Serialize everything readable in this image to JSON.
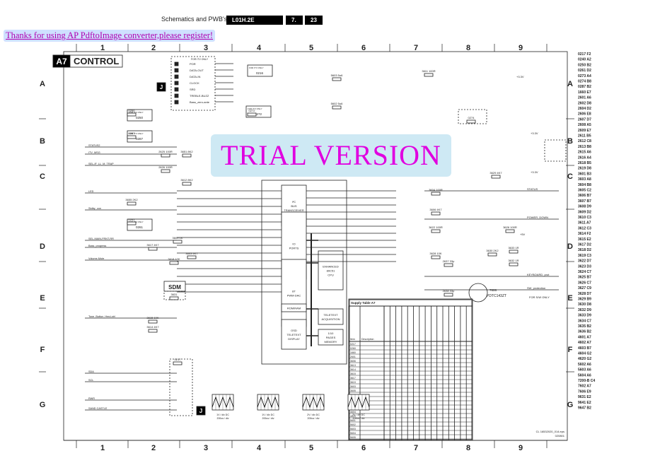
{
  "header": {
    "section": "Schematics and PWB's",
    "model": "L01H.2E",
    "chapter": "7.",
    "page": "23"
  },
  "register_notice": "Thanks for using AP PdftoImage converter,please register!",
  "watermark": "TRIAL VERSION",
  "title": {
    "badge": "A7",
    "name": "CONTROL"
  },
  "grid": {
    "columns": [
      "1",
      "2",
      "3",
      "4",
      "5",
      "6",
      "7",
      "8",
      "9"
    ],
    "rows": [
      "A",
      "B",
      "C",
      "D",
      "E",
      "F",
      "G"
    ]
  },
  "blocks": {
    "transceiver": "I²C BUS TRANSCEIVER",
    "io_ports": "IO PORTS",
    "pwm_dac": "8T PWM-DAC",
    "rom_ram": "ROM/RAM",
    "osd": "OSD TELETEXT DISPLAY",
    "cpu": "ENHANCED 80C51 CPU",
    "acquisition": "TELETEXT ACQUISITION",
    "memory": "1/10 PAGES MEMORY",
    "sdm": "SDM",
    "transistor": "7606 PDTC143ZT",
    "itv1": "FOR ITV ONLY",
    "itv_note": "FOR S/W ONLY"
  },
  "signals": [
    "POR",
    "DATA-OUT",
    "DATA-IN",
    "CLOCK",
    "SRD",
    "TREBLE-BUZZ",
    "Bass_zero-ante",
    "STATUS2",
    "ITV_MSG",
    "SEL-IF_LL_M_TRAP",
    "LED",
    "Stdby_con",
    "SEL-MAIN-FRNT-RR",
    "Bass_progress",
    "Volume-Mute",
    "Tone_Button_Hmd-ctrl",
    "SDA",
    "SCL",
    "RWR",
    "SAND CASTLE",
    "STATUS",
    "POWER_DOWN",
    "KEYBOARD_prot",
    "SW_protection",
    "+3.3V",
    "+5V",
    "+8V"
  ],
  "components": [
    "2625 100R",
    "3651 8K2",
    "2626 100R",
    "3612 8K2",
    "3655 2K2",
    "3609 1K",
    "3617 4K7",
    "3603 4K7",
    "3618 10K",
    "3615 10K",
    "3614 4K7",
    "3611 100R",
    "5603 5u6",
    "5602 5u6",
    "3604 100R",
    "3606 4K7",
    "3622 100R",
    "3628 10K",
    "3629 4K7",
    "3626 100R",
    "3630 2K2",
    "3633 1R",
    "3632 1R",
    "2637 33p",
    "2638 33p",
    "3631",
    "0250",
    "0261",
    "0287",
    "0272",
    "0274",
    "0217"
  ],
  "table": {
    "title": "Supply Table A7",
    "col_item": "Item",
    "col_desc": "Description",
    "rows": [
      "0217",
      "0260",
      "1660",
      "2601",
      "3606",
      "3613",
      "3614",
      "3615",
      "3617",
      "3619",
      "3603",
      "3605",
      "3655",
      "4601",
      "4602",
      "4603",
      "4604",
      "4620",
      "5601",
      "5602",
      "5603",
      "5604",
      "5605"
    ]
  },
  "scopes": [
    "1V / div DC 200us / div",
    "1V / div DC 200us / div",
    "2V / div DC 200us / div",
    "2V / div DC 200us / div"
  ],
  "footer_ref": "CL 16532020_014.eps 020801",
  "reference_list": [
    "0217 F2",
    "0240 A2",
    "0250 B2",
    "0261 D2",
    "0273 A4",
    "0274 B8",
    "0287 B2",
    "1660 E7",
    "2601 A6",
    "2602 D8",
    "2604 D2",
    "2606 E8",
    "2607 D7",
    "2608 A5",
    "2609 E7",
    "2611 B5",
    "2612 C8",
    "2613 B8",
    "2615 A6",
    "2616 A4",
    "2618 B5",
    "2619 D8",
    "3601 B3",
    "3603 A8",
    "3604 B8",
    "3605 C2",
    "3606 B7",
    "3607 B7",
    "3608 D9",
    "3609 D2",
    "3610 C3",
    "3611 A7",
    "3612 C3",
    "3614 F2",
    "3615 E2",
    "3617 D2",
    "3618 D2",
    "3619 C3",
    "3622 D7",
    "3623 D3",
    "3624 C7",
    "3625 B7",
    "3626 C7",
    "3627 C9",
    "3628 D7",
    "3629 B9",
    "3630 D8",
    "3632 D9",
    "3633 D9",
    "3634 C7",
    "3635 B2",
    "3636 B2",
    "4601 A7",
    "4602 A7",
    "4603 B7",
    "4604 G2",
    "4620 G2",
    "5602 A6",
    "5603 A6",
    "5604 A6",
    "7200-B C4",
    "7602 A7",
    "7606 E9",
    "9631 E2",
    "9641 E2",
    "9647 B2"
  ]
}
